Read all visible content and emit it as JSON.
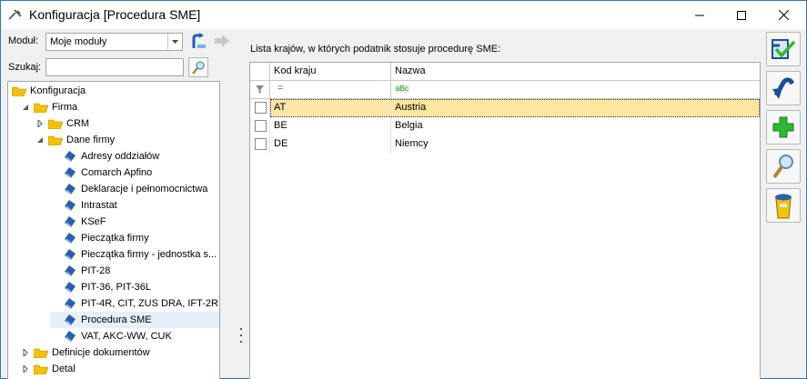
{
  "window": {
    "title": "Konfiguracja [Procedura SME]",
    "minimize_glyph": "—",
    "maximize_glyph": "☐",
    "close_glyph": "✕"
  },
  "left": {
    "module_label": "Moduł:",
    "module_value": "Moje moduły",
    "search_label": "Szukaj:",
    "search_value": ""
  },
  "tree": [
    {
      "label": "Konfiguracja",
      "level": 0,
      "toggle": "",
      "icon": "folder-icon"
    },
    {
      "label": "Firma",
      "level": 1,
      "toggle": "expanded",
      "icon": "folder-icon"
    },
    {
      "label": "CRM",
      "level": 2,
      "toggle": "collapsed",
      "icon": "folder-icon"
    },
    {
      "label": "Dane firmy",
      "level": 2,
      "toggle": "expanded",
      "icon": "folder-icon"
    },
    {
      "label": "Adresy oddziałów",
      "level": 3,
      "toggle": "",
      "icon": "page-icon"
    },
    {
      "label": "Comarch Apfino",
      "level": 3,
      "toggle": "",
      "icon": "page-icon"
    },
    {
      "label": "Deklaracje i pełnomocnictwa",
      "level": 3,
      "toggle": "",
      "icon": "page-icon"
    },
    {
      "label": "Intrastat",
      "level": 3,
      "toggle": "",
      "icon": "page-icon"
    },
    {
      "label": "KSeF",
      "level": 3,
      "toggle": "",
      "icon": "page-icon"
    },
    {
      "label": "Pieczątka firmy",
      "level": 3,
      "toggle": "",
      "icon": "page-icon"
    },
    {
      "label": "Pieczątka firmy - jednostka s...",
      "level": 3,
      "toggle": "",
      "icon": "page-icon"
    },
    {
      "label": "PIT-28",
      "level": 3,
      "toggle": "",
      "icon": "page-icon"
    },
    {
      "label": "PIT-36, PIT-36L",
      "level": 3,
      "toggle": "",
      "icon": "page-icon"
    },
    {
      "label": "PIT-4R, CIT, ZUS DRA, IFT-2R",
      "level": 3,
      "toggle": "",
      "icon": "page-icon"
    },
    {
      "label": "Procedura SME",
      "level": 3,
      "toggle": "",
      "icon": "page-icon",
      "selected": true
    },
    {
      "label": "VAT, AKC-WW, CUK",
      "level": 3,
      "toggle": "",
      "icon": "page-icon"
    },
    {
      "label": "Definicje dokumentów",
      "level": 1,
      "toggle": "collapsed",
      "icon": "folder-icon"
    },
    {
      "label": "Detal",
      "level": 1,
      "toggle": "collapsed",
      "icon": "folder-icon"
    }
  ],
  "grid": {
    "caption": "Lista krajów, w których podatnik stosuje procedurę SME:",
    "columns": [
      "Kod kraju",
      "Nazwa"
    ],
    "filter_eq_symbol": "=",
    "filter_abc_symbol": "aBc",
    "rows": [
      {
        "code": "AT",
        "name": "Austria",
        "checked": false,
        "active": true
      },
      {
        "code": "BE",
        "name": "Belgia",
        "checked": false,
        "active": false
      },
      {
        "code": "DE",
        "name": "Niemcy",
        "checked": false,
        "active": false
      }
    ]
  },
  "toolbar": {
    "buttons": [
      "save-icon",
      "undo-icon",
      "add-icon",
      "preview-icon",
      "delete-icon"
    ]
  },
  "colors": {
    "accent": "#2b78c5",
    "active_row": "#fde6a8",
    "folder": "#f2c200",
    "page_icon": "#2a5fb0",
    "add_green": "#2eb82e"
  }
}
